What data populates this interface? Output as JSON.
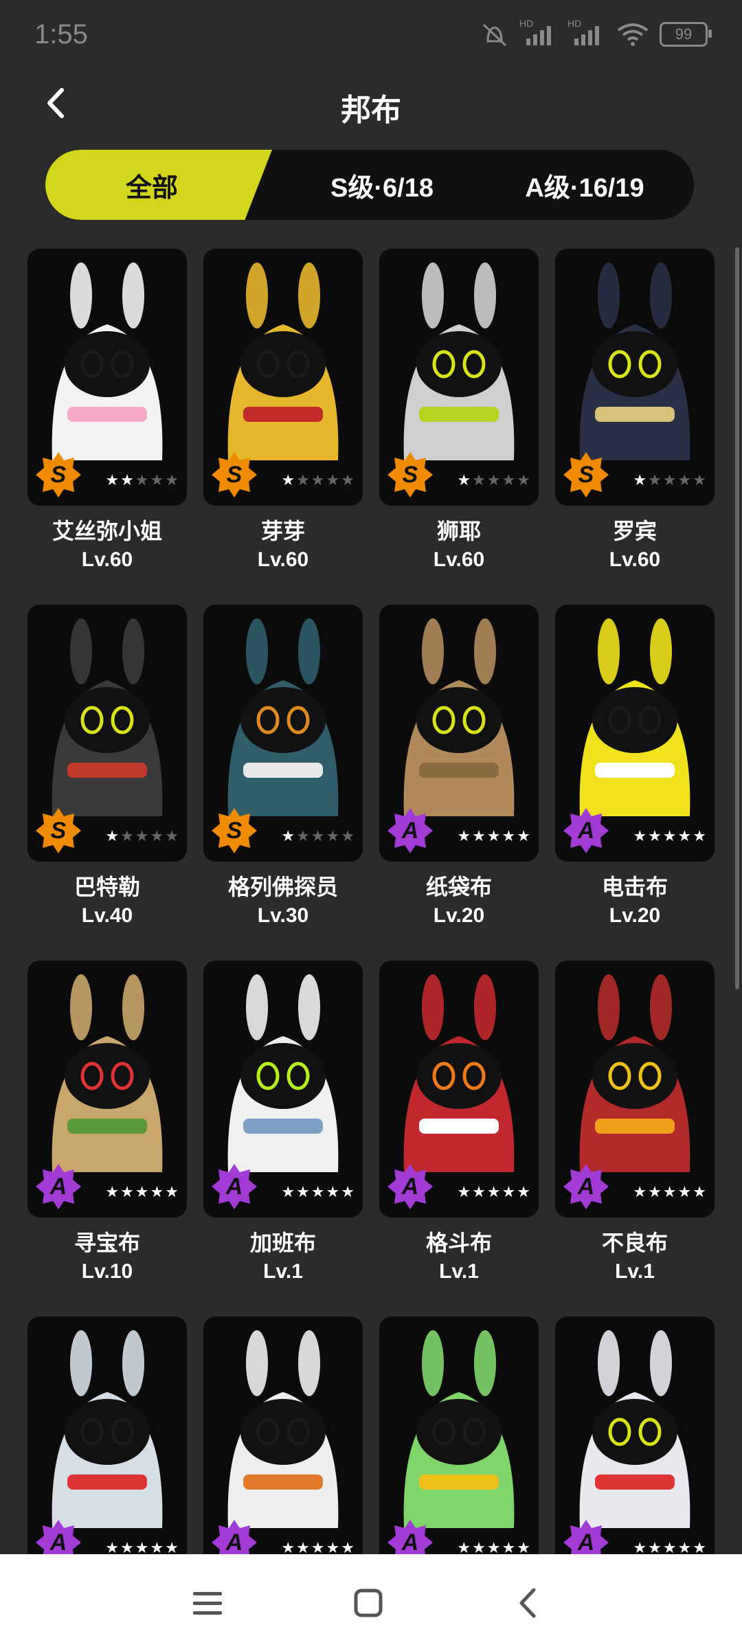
{
  "status": {
    "time": "1:55",
    "battery": "99",
    "signal_hd": "HD"
  },
  "header": {
    "title": "邦布"
  },
  "tabs": [
    {
      "label": "全部",
      "active": true
    },
    {
      "label": "S级·6/18",
      "active": false
    },
    {
      "label": "A级·16/19",
      "active": false
    }
  ],
  "colors": {
    "accent": "#d2d71b",
    "s_rank": "#f08a00",
    "a_rank": "#a23ad6",
    "background": "#2b2b2b"
  },
  "cards": [
    {
      "name": "艾丝弥小姐",
      "level": "Lv.60",
      "rank": "S",
      "stars": 2,
      "body": "#f2f2f2",
      "accent": "#f6a9c6",
      "eye": "#1a1a1a"
    },
    {
      "name": "芽芽",
      "level": "Lv.60",
      "rank": "S",
      "stars": 1,
      "body": "#e6b62c",
      "accent": "#c22a2a",
      "eye": "#1a1a1a"
    },
    {
      "name": "狮耶",
      "level": "Lv.60",
      "rank": "S",
      "stars": 1,
      "body": "#cfcfcf",
      "accent": "#b7d21f",
      "eye": "#d9e31a"
    },
    {
      "name": "罗宾",
      "level": "Lv.60",
      "rank": "S",
      "stars": 1,
      "body": "#2a2f45",
      "accent": "#d8c27a",
      "eye": "#d9e31a"
    },
    {
      "name": "巴特勒",
      "level": "Lv.40",
      "rank": "S",
      "stars": 1,
      "body": "#3a3a3a",
      "accent": "#c0392b",
      "eye": "#d9e31a"
    },
    {
      "name": "格列佛探员",
      "level": "Lv.30",
      "rank": "S",
      "stars": 1,
      "body": "#2f5d6a",
      "accent": "#e9e9e9",
      "eye": "#e08a1e"
    },
    {
      "name": "纸袋布",
      "level": "Lv.20",
      "rank": "A",
      "stars": 5,
      "body": "#b08a5a",
      "accent": "#8a6a40",
      "eye": "#d9e31a"
    },
    {
      "name": "电击布",
      "level": "Lv.20",
      "rank": "A",
      "stars": 5,
      "body": "#f0e21c",
      "accent": "#ffffff",
      "eye": "#1a1a1a"
    },
    {
      "name": "寻宝布",
      "level": "Lv.10",
      "rank": "A",
      "stars": 5,
      "body": "#c9a66b",
      "accent": "#5a9a3a",
      "eye": "#d33"
    },
    {
      "name": "加班布",
      "level": "Lv.1",
      "rank": "A",
      "stars": 5,
      "body": "#f0f0f0",
      "accent": "#7ea0c4",
      "eye": "#b6f01a"
    },
    {
      "name": "格斗布",
      "level": "Lv.1",
      "rank": "A",
      "stars": 5,
      "body": "#c0282d",
      "accent": "#ffffff",
      "eye": "#f07a1a"
    },
    {
      "name": "不良布",
      "level": "Lv.1",
      "rank": "A",
      "stars": 5,
      "body": "#b22a2a",
      "accent": "#f0a01a",
      "eye": "#f0c01a"
    },
    {
      "name": "",
      "level": "",
      "rank": "A",
      "stars": 5,
      "body": "#d6dde4",
      "accent": "#d33",
      "eye": "#1a1a1a"
    },
    {
      "name": "",
      "level": "",
      "rank": "A",
      "stars": 5,
      "body": "#eeeeee",
      "accent": "#e07a2a",
      "eye": "#1a1a1a"
    },
    {
      "name": "",
      "level": "",
      "rank": "A",
      "stars": 5,
      "body": "#7fd56a",
      "accent": "#f0c01a",
      "eye": "#1a1a1a"
    },
    {
      "name": "",
      "level": "",
      "rank": "A",
      "stars": 5,
      "body": "#e8e8ee",
      "accent": "#d33",
      "eye": "#d9e31a"
    }
  ],
  "navbar": {
    "menu_icon": "menu-icon",
    "home_icon": "home-square-icon",
    "back_icon": "back-icon"
  }
}
